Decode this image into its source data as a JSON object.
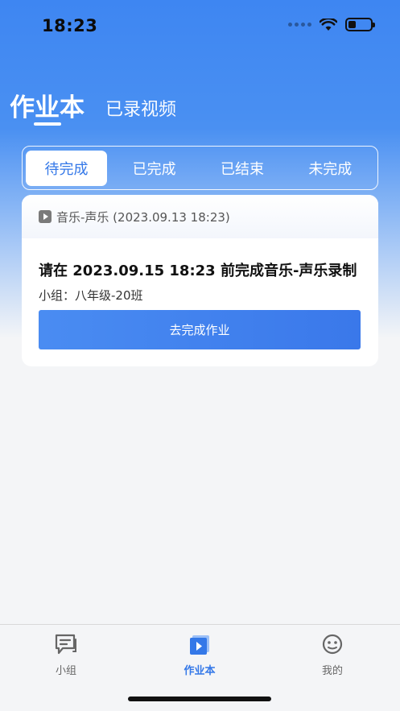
{
  "status_bar": {
    "time": "18:23"
  },
  "header": {
    "tabs": [
      {
        "label": "作业本"
      },
      {
        "label": "已录视频"
      }
    ]
  },
  "segments": [
    {
      "label": "待完成"
    },
    {
      "label": "已完成"
    },
    {
      "label": "已结束"
    },
    {
      "label": "未完成"
    }
  ],
  "card": {
    "subject": "音乐-声乐 (2023.09.13 18:23)",
    "title": "请在 2023.09.15 18:23 前完成音乐-声乐录制",
    "group": "小组：八年级-20班",
    "button_label": "去完成作业"
  },
  "tab_bar": {
    "items": [
      {
        "label": "小组",
        "icon": "chat-icon"
      },
      {
        "label": "作业本",
        "icon": "homework-play-icon"
      },
      {
        "label": "我的",
        "icon": "smiley-icon"
      }
    ]
  },
  "colors": {
    "accent": "#3478e8",
    "hero": "#4a90f2"
  }
}
